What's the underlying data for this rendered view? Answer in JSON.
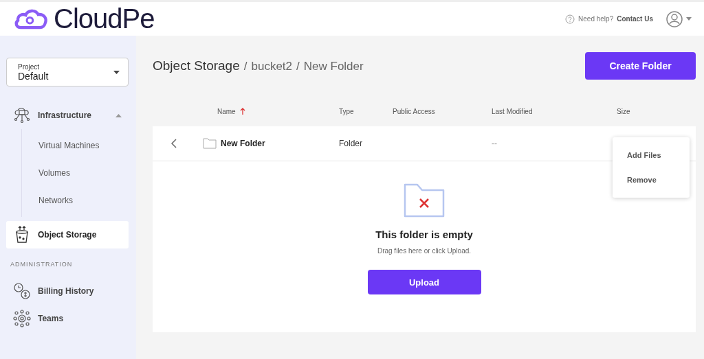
{
  "header": {
    "logo": "CloudPe",
    "help_text": "Need help?",
    "help_link": "Contact Us"
  },
  "sidebar": {
    "project": {
      "label": "Project",
      "value": "Default"
    },
    "items": [
      {
        "kind": "group",
        "label": "Infrastructure",
        "expanded": true,
        "selected": false,
        "children": [
          {
            "label": "Virtual Machines"
          },
          {
            "label": "Volumes"
          },
          {
            "label": "Networks"
          }
        ]
      },
      {
        "kind": "item",
        "label": "Object Storage",
        "selected": true
      },
      {
        "kind": "section",
        "label": "ADMINISTRATION"
      },
      {
        "kind": "item",
        "label": "Billing History",
        "selected": false
      },
      {
        "kind": "item",
        "label": "Teams",
        "selected": false
      }
    ]
  },
  "breadcrumb": [
    {
      "label": "Object Storage"
    },
    {
      "separator": "/",
      "label": "bucket2"
    },
    {
      "separator": "/",
      "label": "New Folder"
    }
  ],
  "create_button": "Create Folder",
  "table": {
    "columns": [
      {
        "label": "Name",
        "sorted": true
      },
      {
        "label": "Type"
      },
      {
        "label": "Public Access"
      },
      {
        "label": "Last Modified"
      },
      {
        "label": "Size"
      }
    ],
    "rows": [
      {
        "name": "New Folder",
        "type": "Folder",
        "last_modified": "--"
      }
    ]
  },
  "context_menu": [
    "Add Files",
    "Remove"
  ],
  "empty_state": {
    "title": "This folder is empty",
    "hint": "Drag files here or click Upload.",
    "button": "Upload"
  }
}
